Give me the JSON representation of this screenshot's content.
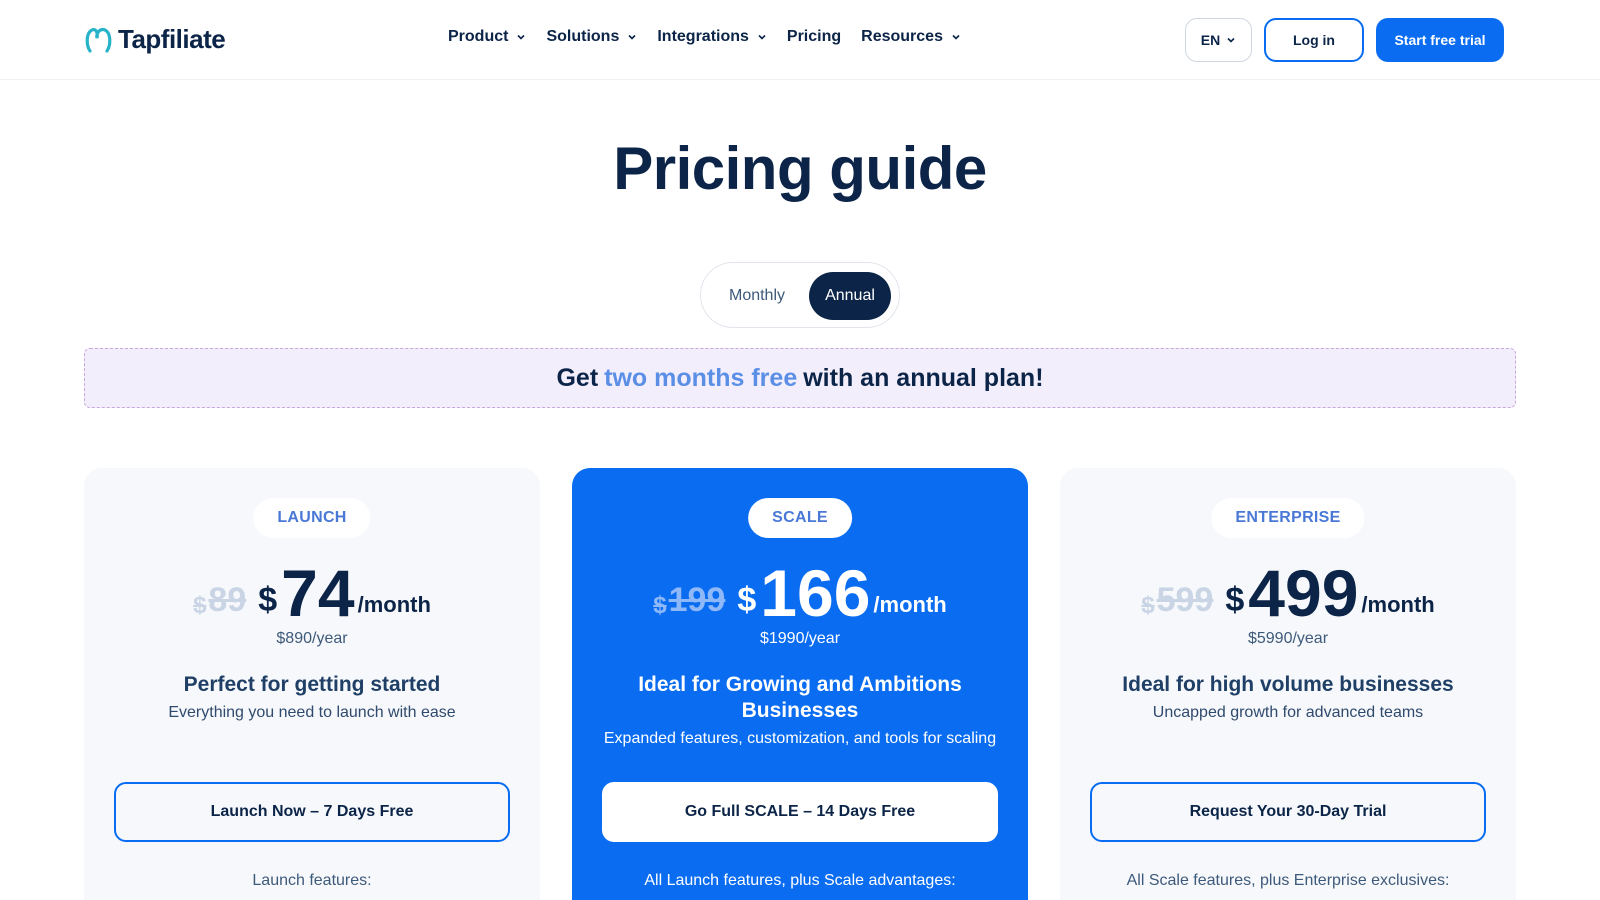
{
  "header": {
    "logo_text": "Tapfiliate",
    "nav": [
      {
        "label": "Product",
        "has_dropdown": true
      },
      {
        "label": "Solutions",
        "has_dropdown": true
      },
      {
        "label": "Integrations",
        "has_dropdown": true
      },
      {
        "label": "Pricing",
        "has_dropdown": false
      },
      {
        "label": "Resources",
        "has_dropdown": true
      }
    ],
    "language": "EN",
    "login_label": "Log in",
    "trial_label": "Start free trial"
  },
  "page_title": "Pricing guide",
  "billing_toggle": {
    "options": [
      "Monthly",
      "Annual"
    ],
    "selected": "Annual"
  },
  "promo": {
    "prefix": "Get",
    "highlight": "two months free",
    "suffix": "with an annual plan!"
  },
  "plans": [
    {
      "badge": "LAUNCH",
      "old_price": "89",
      "price": "74",
      "currency": "$",
      "period": "/month",
      "yearly": "$890/year",
      "tagline": "Perfect for getting started",
      "subtitle": "Everything you need to launch with ease",
      "cta": "Launch Now – 7 Days Free",
      "features_heading": "Launch features:"
    },
    {
      "badge": "SCALE",
      "old_price": "199",
      "price": "166",
      "currency": "$",
      "period": "/month",
      "yearly": "$1990/year",
      "tagline": "Ideal for Growing and Ambitions Businesses",
      "subtitle": "Expanded features, customization, and tools for scaling",
      "cta": "Go Full SCALE – 14 Days Free",
      "features_heading": "All Launch features, plus Scale advantages:"
    },
    {
      "badge": "ENTERPRISE",
      "old_price": "599",
      "price": "499",
      "currency": "$",
      "period": "/month",
      "yearly": "$5990/year",
      "tagline": "Ideal for high volume businesses",
      "subtitle": "Uncapped growth for advanced teams",
      "cta": "Request Your 30-Day Trial",
      "features_heading": "All Scale features, plus Enterprise exclusives:"
    }
  ],
  "colors": {
    "brand_blue": "#0a6cf0",
    "navy": "#0b2447",
    "promo_bg": "#f3eefc",
    "promo_highlight": "#5b8fe6"
  }
}
